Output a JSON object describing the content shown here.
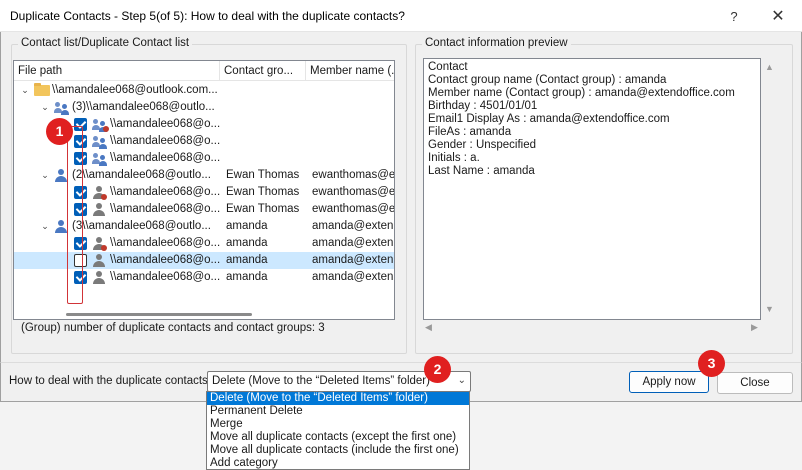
{
  "window": {
    "title": "Duplicate Contacts - Step 5(of 5): How to deal with the duplicate contacts?",
    "help_glyph": "?",
    "close_glyph": "✕"
  },
  "left_panel": {
    "legend": "Contact list/Duplicate Contact list",
    "columns": [
      "File path",
      "Contact gro...",
      "Member name (..."
    ],
    "rows": [
      {
        "level": 0,
        "expander": "⌄",
        "icon": "folder-icon",
        "path": "\\\\amandalee068@outlook.com...",
        "group": "",
        "member": ""
      },
      {
        "level": 1,
        "expander": "⌄",
        "icon": "contact-group-icon",
        "path": "(3)\\\\amandalee068@outlo...",
        "group": "",
        "member": ""
      },
      {
        "level": 2,
        "checked": true,
        "icon": "contact-group-red-dot-icon",
        "path": "\\\\amandalee068@o...",
        "group": "",
        "member": ""
      },
      {
        "level": 2,
        "checked": true,
        "icon": "contact-group-icon",
        "path": "\\\\amandalee068@o...",
        "group": "",
        "member": ""
      },
      {
        "level": 2,
        "checked": true,
        "icon": "contact-group-icon",
        "path": "\\\\amandalee068@o...",
        "group": "",
        "member": ""
      },
      {
        "level": 1,
        "expander": "⌄",
        "icon": "contact-icon",
        "path": "(2\\\\amandalee068@outlo...",
        "group": "Ewan Thomas",
        "member": "ewanthomas@e..."
      },
      {
        "level": 2,
        "checked": true,
        "icon": "contact-red-dot-icon",
        "path": "\\\\amandalee068@o...",
        "group": "Ewan Thomas",
        "member": "ewanthomas@e..."
      },
      {
        "level": 2,
        "checked": true,
        "icon": "contact-icon",
        "path": "\\\\amandalee068@o...",
        "group": "Ewan Thomas",
        "member": "ewanthomas@e..."
      },
      {
        "level": 1,
        "expander": "⌄",
        "icon": "contact-icon",
        "path": "(3\\\\amandalee068@outlo...",
        "group": "amanda",
        "member": "amanda@exten..."
      },
      {
        "level": 2,
        "checked": true,
        "icon": "contact-red-dot-icon",
        "path": "\\\\amandalee068@o...",
        "group": "amanda",
        "member": "amanda@exten..."
      },
      {
        "level": 2,
        "checked": false,
        "selected": true,
        "icon": "contact-icon",
        "path": "\\\\amandalee068@o...",
        "group": "amanda",
        "member": "amanda@exten..."
      },
      {
        "level": 2,
        "checked": true,
        "icon": "contact-icon",
        "path": "\\\\amandalee068@o...",
        "group": "amanda",
        "member": "amanda@exten..."
      }
    ],
    "summary": "(Group) number of duplicate contacts and contact groups:  3"
  },
  "right_panel": {
    "legend": "Contact information preview",
    "lines": [
      "Contact",
      "Contact group name (Contact group) : amanda",
      "Member name (Contact group) : amanda@extendoffice.com",
      "Birthday : 4501/01/01",
      "Email1 Display As : amanda@extendoffice.com",
      "FileAs : amanda",
      "Gender : Unspecified",
      "Initials : a.",
      "Last Name : amanda"
    ]
  },
  "footer": {
    "label": "How to deal with the duplicate contacts?",
    "combo_value": "Delete (Move to the “Deleted Items” folder)",
    "apply_label": "Apply now",
    "close_label": "Close"
  },
  "dropdown": {
    "options": [
      "Delete (Move to the “Deleted Items” folder)",
      "Permanent Delete",
      "Merge",
      "Move all duplicate contacts (except the first one)",
      "Move all duplicate contacts (include the first one)",
      "Add category"
    ],
    "selected_index": 0
  },
  "badges": [
    "1",
    "2",
    "3"
  ],
  "colors": {
    "accent": "#005fb8",
    "selection": "#cce8ff",
    "dropdown_selection": "#0078d7",
    "badge": "#e02020",
    "highlight_border": "#d13438"
  }
}
